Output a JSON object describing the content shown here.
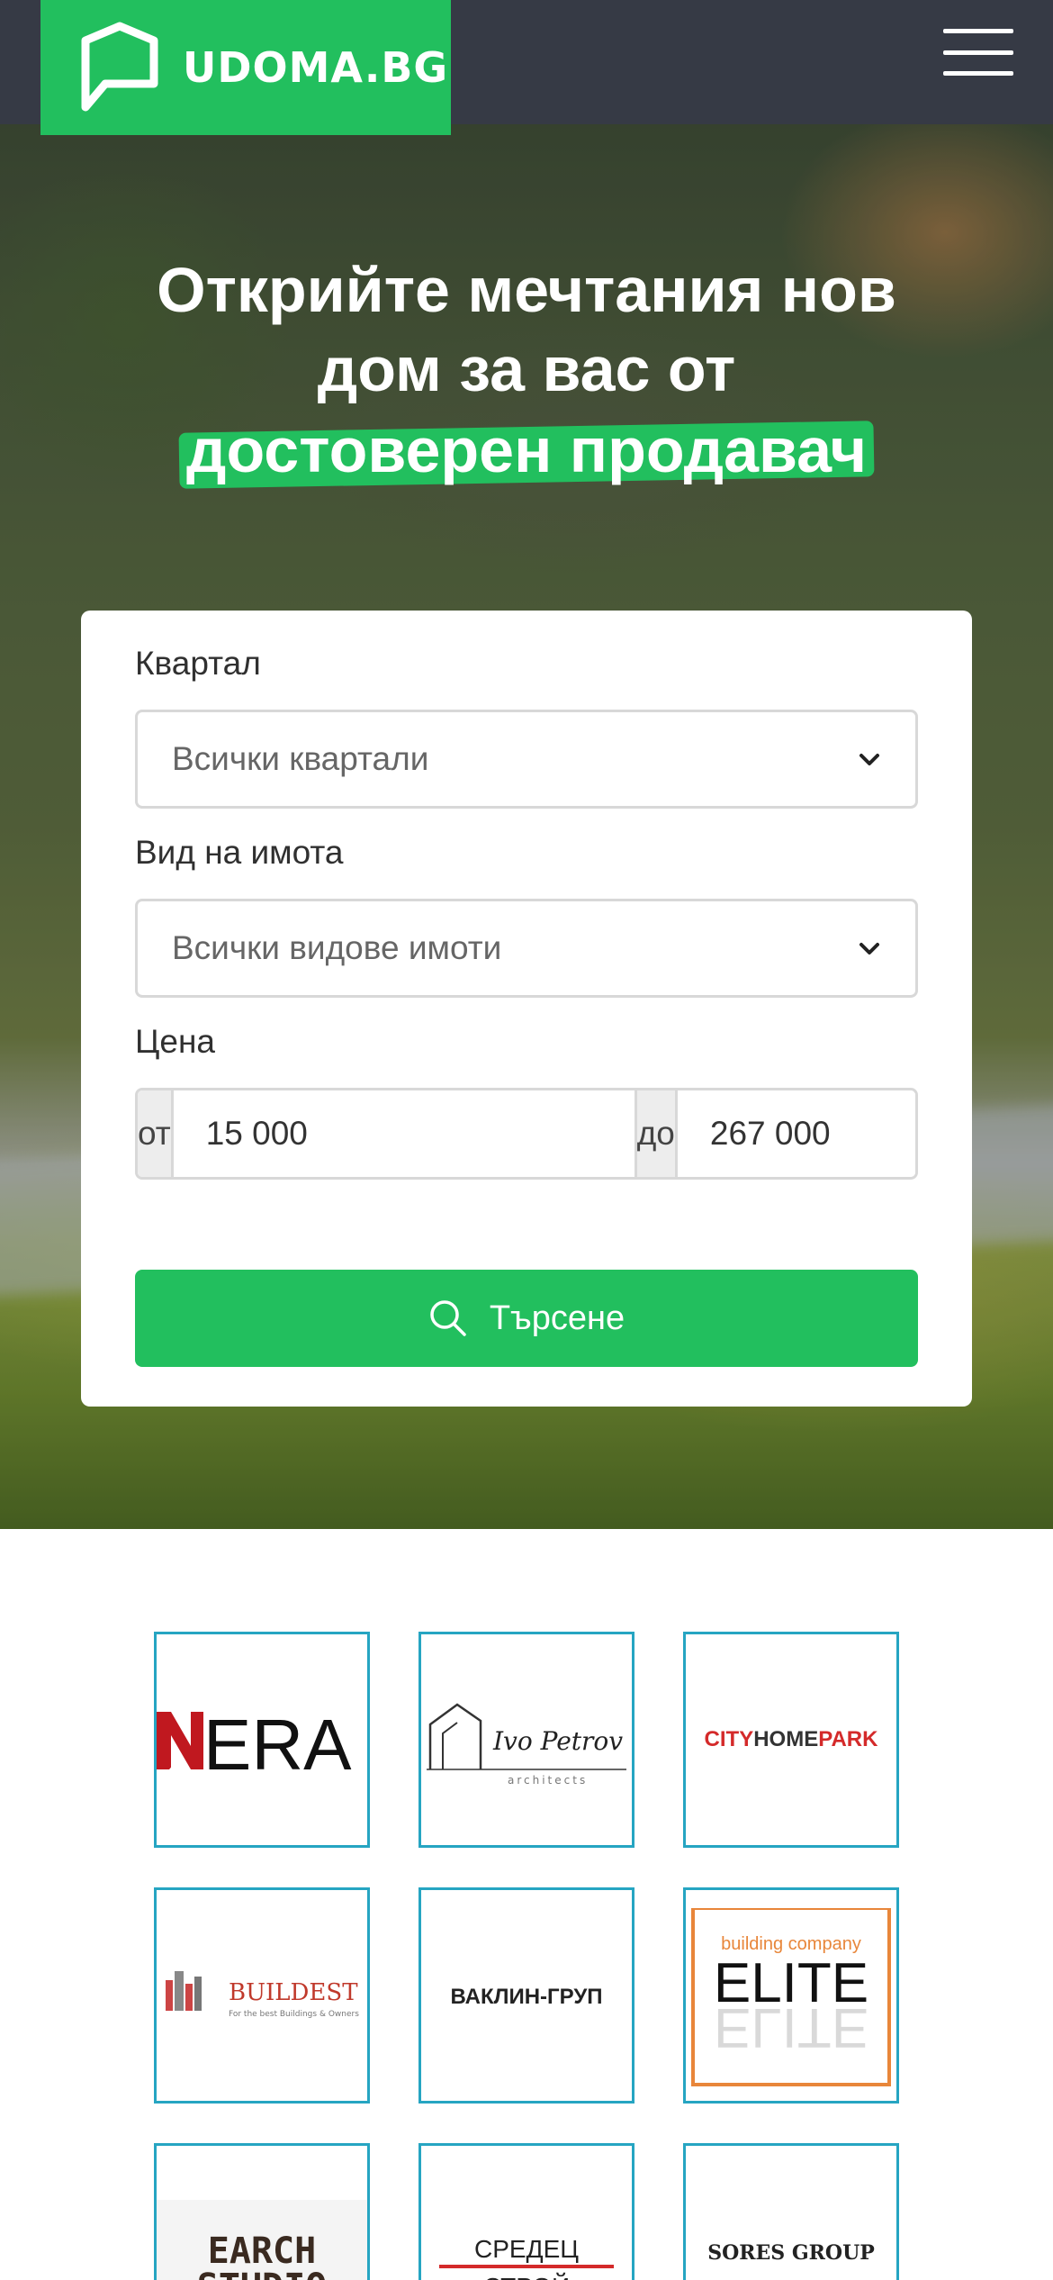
{
  "header": {
    "logo_text": "UDOMA.BG",
    "brand_color": "#22bf5e",
    "menu_icon": "hamburger-menu-icon"
  },
  "hero": {
    "title_line1": "Открийте мечтания нов",
    "title_line2": "дом за вас от",
    "title_highlight": "достоверен продавач"
  },
  "search": {
    "district": {
      "label": "Квартал",
      "value": "Всички квартали"
    },
    "property_type": {
      "label": "Вид на имота",
      "value": "Всички видове имоти"
    },
    "price": {
      "label": "Цена",
      "from_label": "от",
      "from_value": "15 000",
      "to_label": "до",
      "to_value": "267 000",
      "currency": "€"
    },
    "button_label": "Търсене",
    "button_icon": "search-icon"
  },
  "partners": [
    {
      "name": "NERA",
      "text": "ERA"
    },
    {
      "name": "Ivo Petrov",
      "text": "Ivo Petrov",
      "sub": "architects"
    },
    {
      "name": "CITYHOMEPARK",
      "text_red": "CITY",
      "text_dark": "HOME",
      "text_red2": "PARK"
    },
    {
      "name": "BUILDEST",
      "text": "BUILDEST",
      "sub": "For the best Buildings & Owners"
    },
    {
      "name": "ВАКЛИН-ГРУП",
      "text": "ВАКЛИН-ГРУП"
    },
    {
      "name": "ELITE",
      "text": "ELITE",
      "sub": "building company"
    },
    {
      "name": "EARCH STUDIO",
      "text_top": "EARCH",
      "text_bottom": "STUDIO"
    },
    {
      "name": "СРЕДЕЦ СТРОЙ",
      "text_top": "СРЕДЕЦ",
      "text_bottom": "СТРОЙ"
    },
    {
      "name": "SORES GROUP",
      "text": "SORES GROUP"
    }
  ]
}
